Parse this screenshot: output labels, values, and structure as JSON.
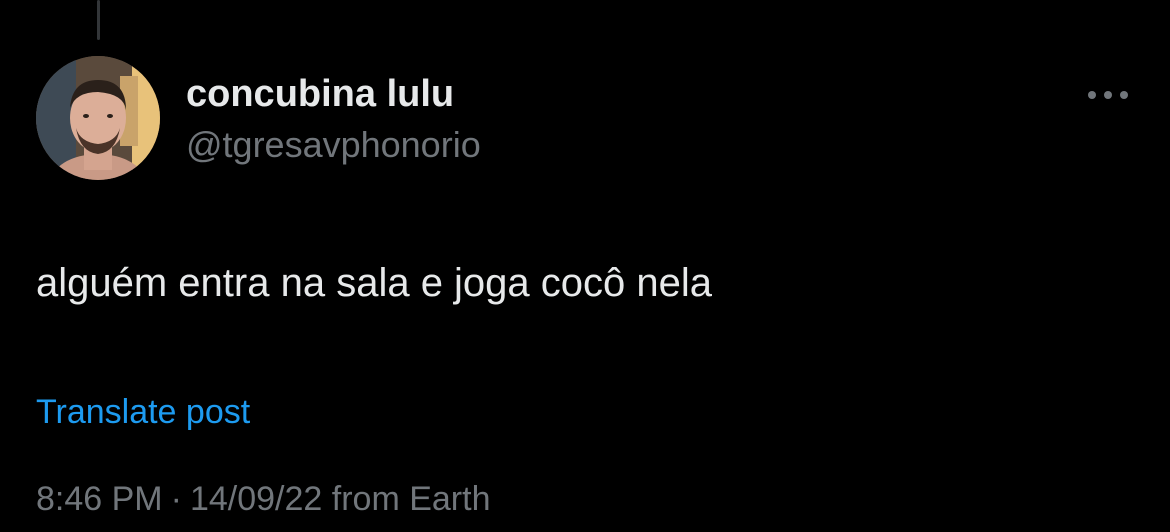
{
  "tweet": {
    "author": {
      "display_name": "concubina lulu",
      "handle": "@tgresavphonorio",
      "avatar": "profile-photo"
    },
    "more_icon": "ellipsis-icon",
    "text": "alguém entra na sala e joga cocô nela",
    "translate_label": "Translate post",
    "time": "8:46 PM",
    "separator": "·",
    "date": "14/09/22",
    "source": "from Earth"
  },
  "colors": {
    "background": "#000000",
    "primary_text": "#e7e9ea",
    "secondary_text": "#71767b",
    "link": "#1d9bf0",
    "thread_line": "#333639"
  }
}
